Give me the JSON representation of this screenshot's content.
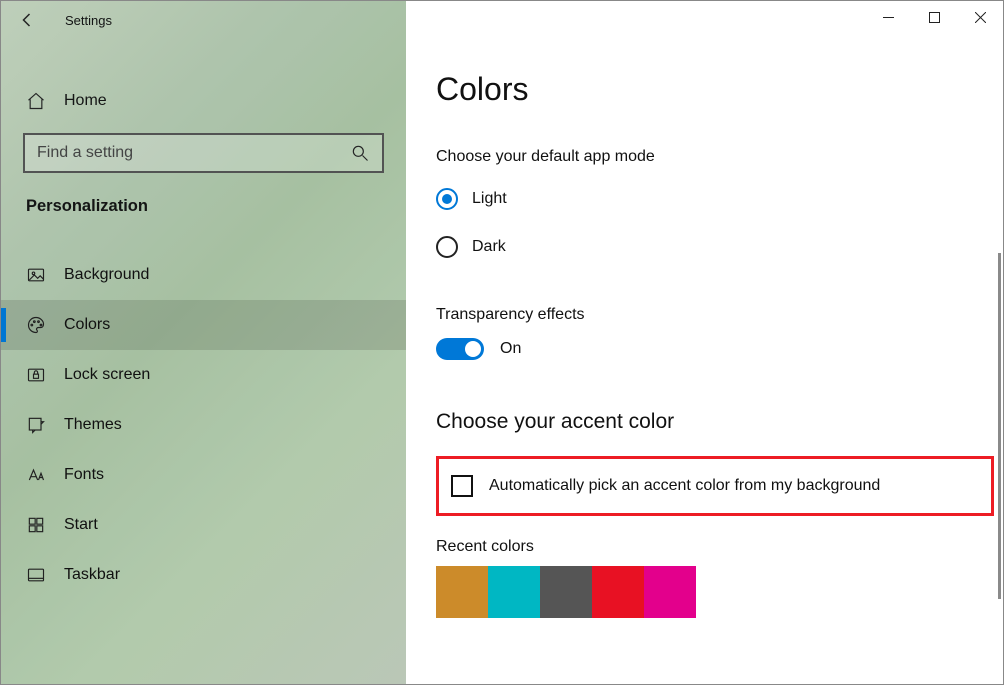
{
  "window": {
    "app_title": "Settings"
  },
  "sidebar": {
    "home_label": "Home",
    "search_placeholder": "Find a setting",
    "category_label": "Personalization",
    "items": [
      {
        "label": "Background"
      },
      {
        "label": "Colors"
      },
      {
        "label": "Lock screen"
      },
      {
        "label": "Themes"
      },
      {
        "label": "Fonts"
      },
      {
        "label": "Start"
      },
      {
        "label": "Taskbar"
      }
    ]
  },
  "main": {
    "page_title": "Colors",
    "app_mode_label": "Choose your default app mode",
    "app_mode_options": {
      "light": "Light",
      "dark": "Dark"
    },
    "transparency_label": "Transparency effects",
    "transparency_state": "On",
    "accent_section_title": "Choose your accent color",
    "auto_accent_label": "Automatically pick an accent color from my background",
    "recent_colors_label": "Recent colors",
    "recent_colors": [
      "#cc8b2a",
      "#00b7c3",
      "#555555",
      "#e81123",
      "#e3008c"
    ]
  }
}
